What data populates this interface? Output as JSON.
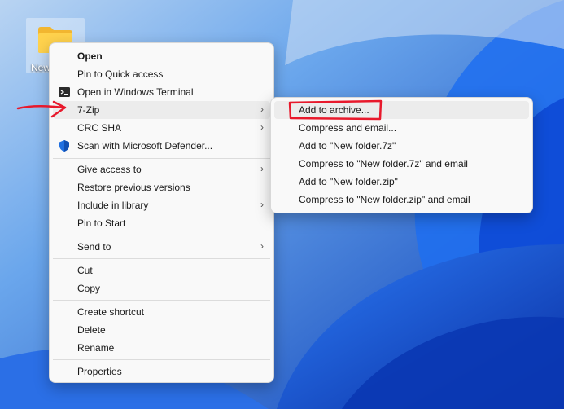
{
  "desktop": {
    "folder_label": "New folder"
  },
  "context_menu": {
    "items": [
      {
        "label": "Open"
      },
      {
        "label": "Pin to Quick access"
      },
      {
        "label": "Open in Windows Terminal",
        "icon": "terminal-icon"
      },
      {
        "label": "7-Zip"
      },
      {
        "label": "CRC SHA"
      },
      {
        "label": "Scan with Microsoft Defender...",
        "icon": "defender-shield-icon"
      },
      {
        "label": "Give access to"
      },
      {
        "label": "Restore previous versions"
      },
      {
        "label": "Include in library"
      },
      {
        "label": "Pin to Start"
      },
      {
        "label": "Send to"
      },
      {
        "label": "Cut"
      },
      {
        "label": "Copy"
      },
      {
        "label": "Create shortcut"
      },
      {
        "label": "Delete"
      },
      {
        "label": "Rename"
      },
      {
        "label": "Properties"
      }
    ]
  },
  "submenu_7zip": {
    "items": [
      {
        "label": "Add to archive..."
      },
      {
        "label": "Compress and email..."
      },
      {
        "label": "Add to \"New folder.7z\""
      },
      {
        "label": "Compress to \"New folder.7z\" and email"
      },
      {
        "label": "Add to \"New folder.zip\""
      },
      {
        "label": "Compress to \"New folder.zip\" and email"
      }
    ]
  },
  "colors": {
    "annotation": "#e8192c",
    "wallpaper": "#1b55c9"
  }
}
